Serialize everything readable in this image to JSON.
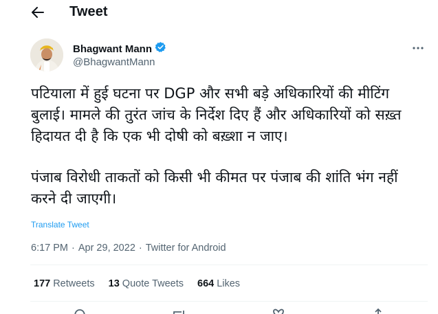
{
  "header": {
    "title": "Tweet"
  },
  "author": {
    "name": "Bhagwant Mann",
    "handle": "@BhagwantMann"
  },
  "tweet": {
    "paragraph1": "पटियाला में हुई घटना पर DGP और सभी बड़े अधिकारियों की मीटिंग बुलाई। मामले की तुरंत जांच के निर्देश दिए हैं और अधिकारियों को सख़्त हिदायत दी है कि एक भी दोषी को बख़्शा न जाए।",
    "paragraph2": "पंजाब विरोधी ताकतों को किसी भी कीमत पर पंजाब की शांति भंग नहीं करने दी जाएगी।"
  },
  "translate_label": "Translate Tweet",
  "meta": {
    "time": "6:17 PM",
    "separator": "·",
    "date": "Apr 29, 2022",
    "source": "Twitter for Android"
  },
  "stats": {
    "retweets_count": "177",
    "retweets_label": "Retweets",
    "quotes_count": "13",
    "quotes_label": "Quote Tweets",
    "likes_count": "664",
    "likes_label": "Likes"
  },
  "colors": {
    "link": "#1d9bf0",
    "secondary_text": "#536471",
    "verified": "#1d9bf0"
  }
}
